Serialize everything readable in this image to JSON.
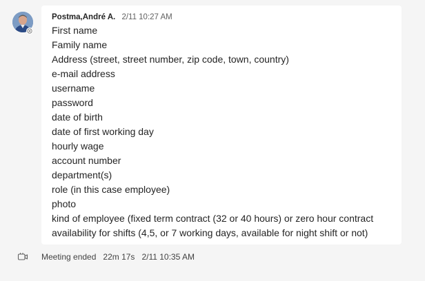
{
  "message": {
    "author": "Postma,André A.",
    "timestamp": "2/11 10:27 AM",
    "lines": [
      "First name",
      "Family name",
      "Address (street, street number, zip code, town, country)",
      "e-mail address",
      "username",
      "password",
      "date of birth",
      "date of first working day",
      "hourly wage",
      "account number",
      "department(s)",
      "role (in this case employee)",
      "photo",
      "kind of employee (fixed term contract (32 or 40 hours) or zero hour contract",
      "availability for shifts (4,5, or 7 working days, available for night shift or not)"
    ],
    "avatar_icon": "user-photo-icon",
    "presence_icon": "presence-offline-icon"
  },
  "meeting": {
    "icon": "meeting-camera-icon",
    "status": "Meeting ended",
    "duration": "22m 17s",
    "timestamp": "2/11 10:35 AM"
  },
  "colors": {
    "background": "#f5f5f5",
    "bubble": "#ffffff",
    "text": "#242424",
    "secondary_text": "#616161"
  }
}
